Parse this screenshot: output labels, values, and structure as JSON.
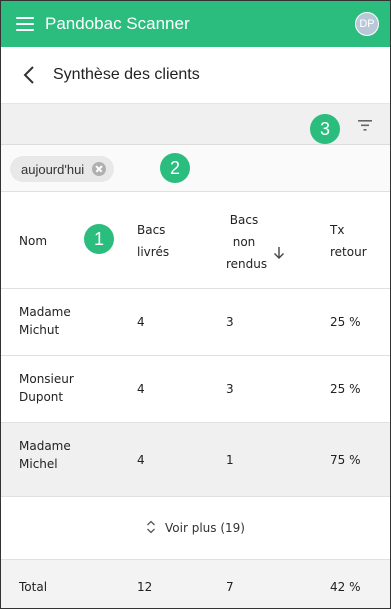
{
  "app": {
    "title": "Pandobac Scanner",
    "avatar_initials": "DP",
    "accent_color": "#2bbd7e"
  },
  "page": {
    "title": "Synthèse des clients"
  },
  "filter": {
    "chip_label": "aujourd'hui"
  },
  "markers": {
    "one": "1",
    "two": "2",
    "three": "3"
  },
  "table": {
    "headers": {
      "nom": "Nom",
      "livres_1": "Bacs",
      "livres_2": "livrés",
      "nonrendus_1": "Bacs",
      "nonrendus_2": "non",
      "nonrendus_3": "rendus",
      "retour_1": "Tx",
      "retour_2": "retour"
    },
    "rows": [
      {
        "name_1": "Madame",
        "name_2": "Michut",
        "livres": "4",
        "non_rendus": "3",
        "retour": "25 %"
      },
      {
        "name_1": "Monsieur",
        "name_2": "Dupont",
        "livres": "4",
        "non_rendus": "3",
        "retour": "25 %"
      },
      {
        "name_1": "Madame",
        "name_2": "Michel",
        "livres": "4",
        "non_rendus": "1",
        "retour": "75 %"
      }
    ],
    "more_label": "Voir plus (19)",
    "total": {
      "label": "Total",
      "livres": "12",
      "non_rendus": "7",
      "retour": "42 %"
    }
  }
}
